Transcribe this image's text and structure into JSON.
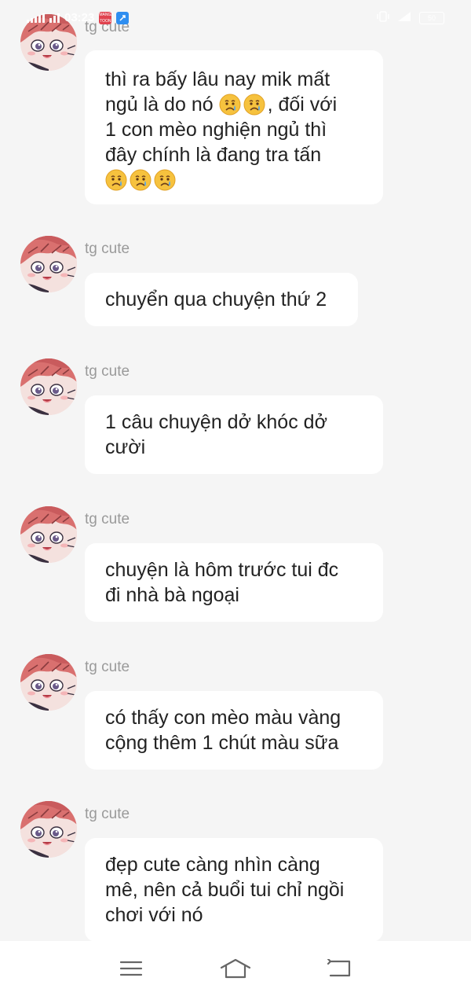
{
  "status_bar": {
    "time": "03:23",
    "app_badge_text": "MANGA TOON",
    "battery_level": "50"
  },
  "messages": [
    {
      "sender": "tg cute",
      "line1": "thì ra bấy lâu nay mik mất",
      "line2_a": "ngủ là do nó ",
      "line2_b": ", đối với",
      "line3": "1 con mèo nghiện ngủ thì",
      "line4": "đây chính là đang tra tấn"
    },
    {
      "sender": "tg cute",
      "line1": "chuyển qua chuyện thứ 2"
    },
    {
      "sender": "tg cute",
      "line1": "1 câu chuyện dở khóc dở",
      "line2": "cười"
    },
    {
      "sender": "tg cute",
      "line1": "chuyện là hôm trước tui đc",
      "line2": "đi nhà bà ngoại"
    },
    {
      "sender": "tg cute",
      "line1": "có thấy con mèo màu vàng",
      "line2": "cộng thêm 1 chút màu sữa"
    },
    {
      "sender": "tg cute",
      "line1": "đẹp cute càng nhìn càng",
      "line2": "mê, nên cả buổi tui chỉ ngồi",
      "line3": "chơi với nó"
    }
  ],
  "emoji_name": "crying-face-emoji",
  "nav_bar": {
    "menu_icon": "menu-icon",
    "home_icon": "home-icon",
    "back_icon": "back-icon"
  }
}
